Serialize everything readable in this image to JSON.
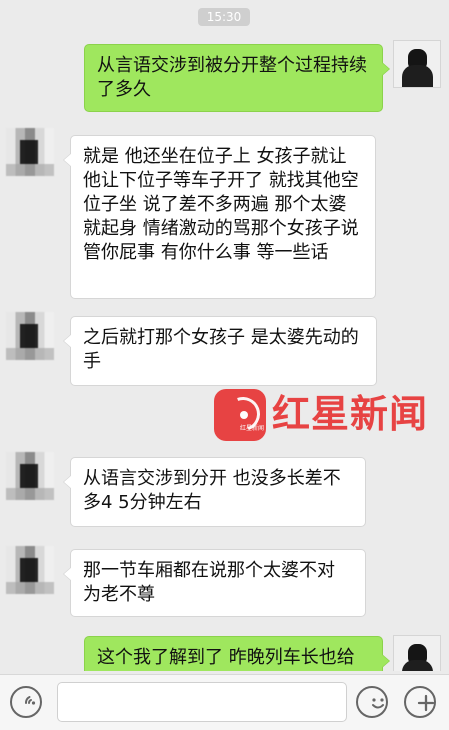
{
  "status": {
    "time": "15:30"
  },
  "messages": [
    {
      "side": "right",
      "text": "从言语交涉到被分开整个过程持续了多久"
    },
    {
      "side": "left",
      "text": "就是 他还坐在位子上   女孩子就让他让下位子等车子开了 就找其他空位子坐   说了差不多两遍 那个太婆就起身 情绪激动的骂那个女孩子说管你屁事 有你什么事 等一些话"
    },
    {
      "side": "left",
      "text": "之后就打那个女孩子  是太婆先动的手"
    },
    {
      "side": "left",
      "text": "从语言交涉到分开   也没多长差不多4 5分钟左右"
    },
    {
      "side": "left",
      "text": "那一节车厢都在说那个太婆不对 为老不尊"
    },
    {
      "side": "right",
      "text": "这个我了解到了 昨晚列车长也给"
    }
  ],
  "watermark": {
    "brand_text": "红星新闻",
    "logo_small_text": "红星新闻"
  },
  "composer": {
    "input_value": "",
    "placeholder": "",
    "voice_icon": "voice-icon",
    "emoji_icon": "emoji-icon",
    "plus_icon": "plus-icon"
  },
  "colors": {
    "background": "#ebebeb",
    "outgoing_bubble": "#9fe75e",
    "incoming_bubble": "#ffffff",
    "watermark_red": "#e73b3b"
  }
}
